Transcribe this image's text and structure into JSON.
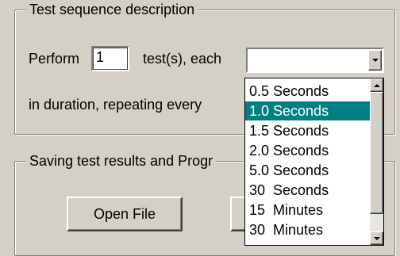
{
  "test_sequence": {
    "title": "Test sequence description",
    "perform_label": "Perform",
    "test_count": "1",
    "tests_each_label": "test(s), each",
    "duration_value": "",
    "repeat_label": "in duration, repeating every"
  },
  "saving": {
    "title": "Saving test results and Progr",
    "open_file_label": "Open File"
  },
  "duration_dropdown": {
    "options": [
      "0.5 Seconds",
      "1.0 Seconds",
      "1.5 Seconds",
      "2.0 Seconds",
      "5.0 Seconds",
      "30  Seconds",
      "15  Minutes",
      "30  Minutes"
    ],
    "selected": "1.0 Seconds"
  },
  "colors": {
    "face": "#d4d0c8",
    "highlight": "#008080"
  }
}
